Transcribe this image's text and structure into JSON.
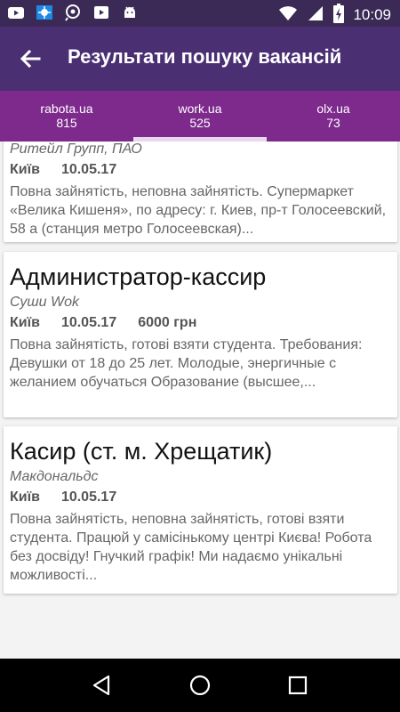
{
  "status_bar": {
    "time": "10:09",
    "icons": [
      "youtube-icon",
      "weather-icon",
      "search-icon",
      "video-icon",
      "android-icon",
      "wifi-icon",
      "signal-icon",
      "battery-icon"
    ]
  },
  "app_bar": {
    "title": "Результати пошуку вакансій",
    "back_icon": "arrow-back-icon"
  },
  "tabs": [
    {
      "name": "rabota.ua",
      "count": "815"
    },
    {
      "name": "work.ua",
      "count": "525"
    },
    {
      "name": "olx.ua",
      "count": "73"
    }
  ],
  "active_tab": 1,
  "jobs": [
    {
      "title": "",
      "company": "Ритейл Групп, ПАО",
      "city": "Київ",
      "date": "10.05.17",
      "salary": "",
      "description": "Повна зайнятість, неповна зайнятість. Супермаркет «Велика Кишеня», по адресу: г. Киев, пр-т Голосеевский, 58 а (станция метро Голосеевская)..."
    },
    {
      "title": "Администратор-кассир",
      "company": "Суши Wok",
      "city": "Київ",
      "date": "10.05.17",
      "salary": "6000 грн",
      "description": "Повна зайнятість, готові взяти студента. Требования: Девушки от 18 до 25 лет. Молодые, энергичные с желанием обучаться Образование (высшее,..."
    },
    {
      "title": "Касир (ст. м. Хрещатик)",
      "company": "Макдональдс",
      "city": "Київ",
      "date": "10.05.17",
      "salary": "",
      "description": "Повна зайнятість, неповна зайнятість, готові взяти студента. Працюй у самісінькому центрі Києва! Робота без досвіду! Гнучкий графік! Ми надаємо унікальні можливості..."
    }
  ],
  "colors": {
    "status_bar": "#3a2a55",
    "app_bar": "#4b2f73",
    "tabs": "#7d2a8c",
    "tab_indicator": "#e8d8ee"
  },
  "nav": [
    "back-triangle-icon",
    "home-circle-icon",
    "recents-square-icon"
  ]
}
